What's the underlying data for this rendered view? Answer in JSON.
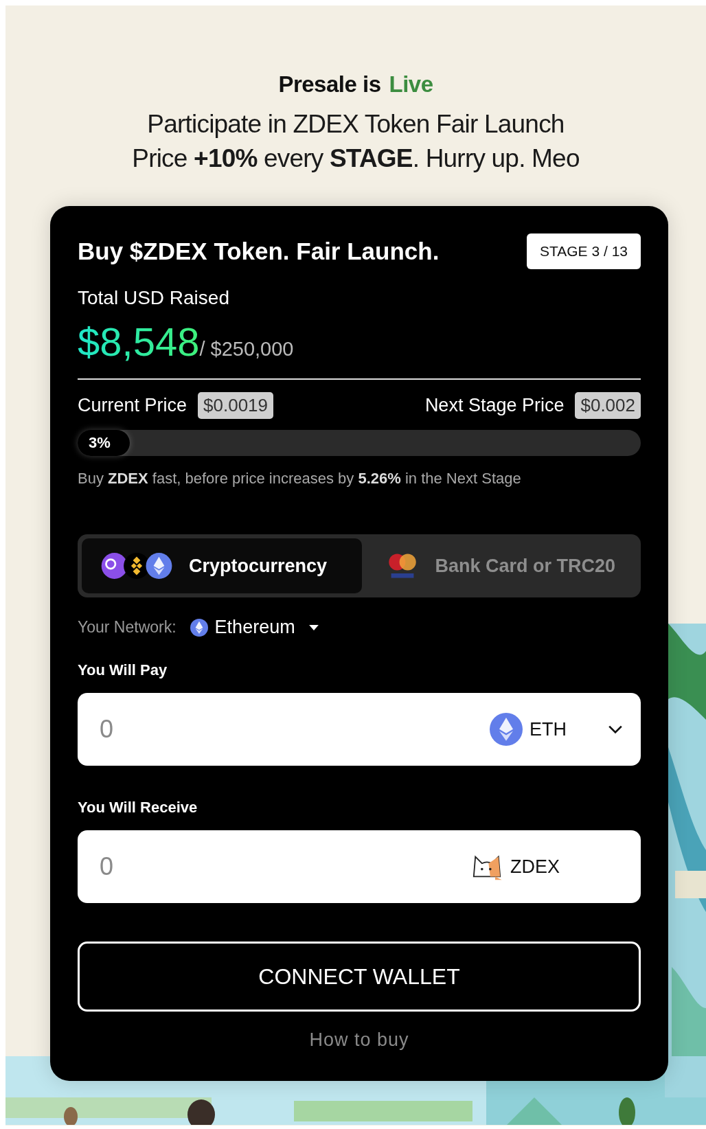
{
  "header": {
    "title": "Presale is",
    "highlight": "Live",
    "lines": [
      "Participate in ZDEX Token Fair Launch",
      "Price **+10%** every **STAGE**. Hurry up. Meo"
    ]
  },
  "widget": {
    "title": "Buy $ZDEX Token. Fair Launch.",
    "stage_badge": "STAGE 3 / 13",
    "raised_label": "Total USD Raised",
    "raised": "$8,548",
    "target": "/ $250,000",
    "current_price_label": "Current Price",
    "current_price": "$0.0019",
    "next_price_label": "Next Stage Price",
    "next_price": "$0.002",
    "progress": {
      "reading": "3%"
    },
    "note": "Buy **ZDEX** fast, before price increases by **5.26%** in the Next Stage",
    "payment_tabs": [
      {
        "kind": "crypto",
        "label": "Cryptocurrency",
        "selected": true
      },
      {
        "kind": "card",
        "label": "Bank Card or TRC20",
        "selected": false
      }
    ],
    "network": {
      "label": "Your Network:",
      "value": "Ethereum"
    },
    "pay": {
      "label": "You Will Pay",
      "placeholder": "0",
      "currency": "ETH",
      "kind": "eth"
    },
    "receive": {
      "label": "You Will Receive",
      "placeholder": "0",
      "currency": "ZDEX",
      "kind": "cat"
    },
    "connect_button": "CONNECT WALLET",
    "help_link": "How to buy"
  }
}
